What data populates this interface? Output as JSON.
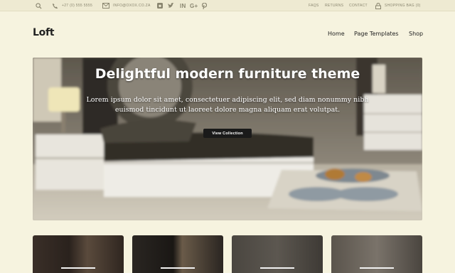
{
  "topbar": {
    "phone": "+27 (0) 555 5555",
    "email": "info@oxox.co.za",
    "links": [
      "Faqs",
      "Returns",
      "Contact"
    ],
    "cart": "Shopping bag (0)",
    "social": [
      "instagram-icon",
      "twitter-icon",
      "linkedin-icon",
      "google-plus-icon",
      "pinterest-icon"
    ]
  },
  "header": {
    "logo": "Loft",
    "nav": [
      "Home",
      "Page Templates",
      "Shop"
    ]
  },
  "hero": {
    "title": "Delightful modern furniture theme",
    "text": "Lorem ipsum dolor sit amet, consectetuer adipiscing elit, sed diam nonummy nibh euismod tincidunt ut laoreet dolore magna aliquam erat volutpat.",
    "button": "View Collection"
  },
  "colors": {
    "background": "#f6f3df",
    "topbar": "#eeead2",
    "button": "#1a1a1a"
  }
}
